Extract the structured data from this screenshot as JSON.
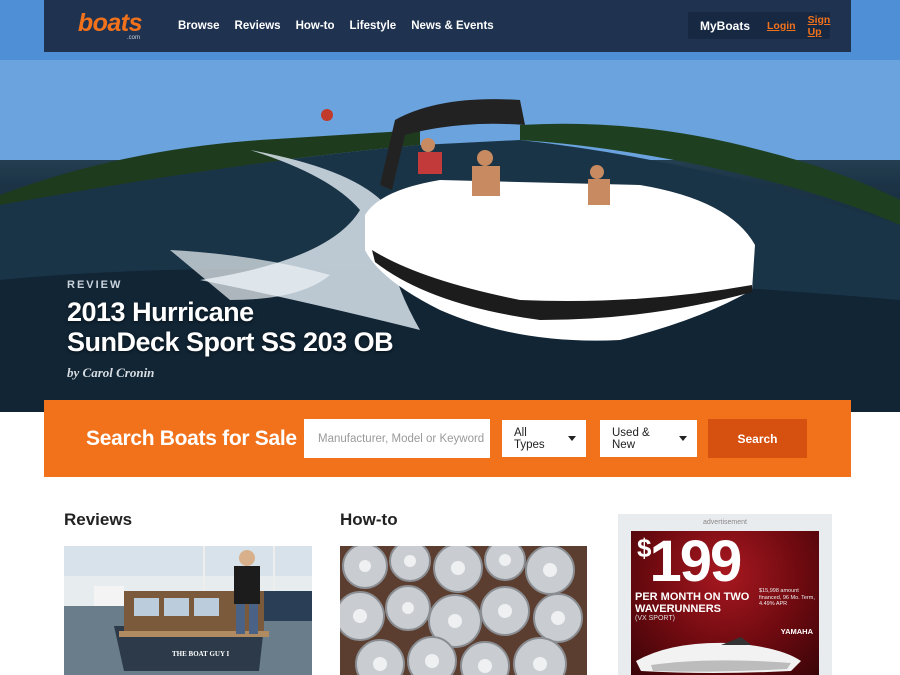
{
  "header": {
    "logo_text": "boats",
    "logo_suffix": ".com",
    "nav": [
      "Browse",
      "Reviews",
      "How-to",
      "Lifestyle",
      "News & Events"
    ],
    "account": {
      "my_label": "MyBoats",
      "login": "Login",
      "signup": "Sign Up"
    }
  },
  "hero": {
    "kicker": "REVIEW",
    "headline_line1": "2013 Hurricane",
    "headline_line2": "SunDeck Sport SS 203 OB",
    "byline": "by Carol Cronin",
    "hull_name": "THE BOAT GUY I"
  },
  "search": {
    "title": "Search Boats for Sale",
    "placeholder": "Manufacturer, Model or Keyword",
    "type_value": "All Types",
    "condition_value": "Used & New",
    "button": "Search"
  },
  "sections": {
    "reviews_title": "Reviews",
    "howto_title": "How-to"
  },
  "ad": {
    "label": "advertisement",
    "currency": "$",
    "price": "199",
    "line1": "PER MONTH ON TWO",
    "line2": "WAVERUNNERS",
    "line3": "(VX SPORT)",
    "fine": "$15,998 amount financed, 96 Mo. Term, 4.49% APR",
    "brand": "YAMAHA"
  },
  "colors": {
    "brand_orange": "#f2721c",
    "header_navy": "#1f3350",
    "search_button": "#d65010"
  }
}
